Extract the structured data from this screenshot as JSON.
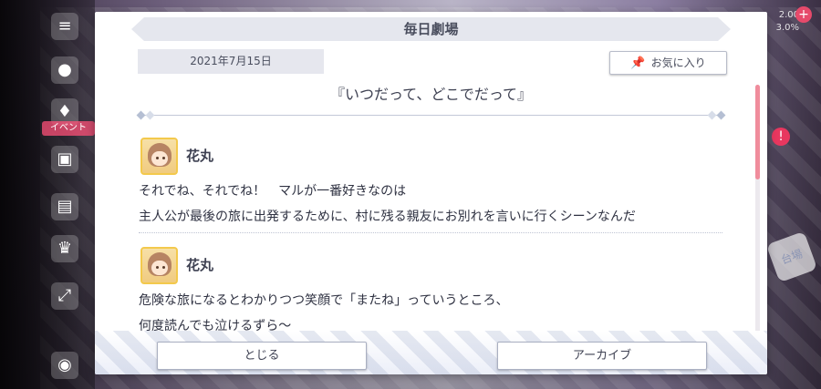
{
  "screen": {
    "background": {
      "side_menu_tag": "イベント",
      "top_right_text": "2.00\n3.0%",
      "right_deco_text": "台場"
    }
  },
  "dialog": {
    "title": "毎日劇場",
    "date": "2021年7月15日",
    "favorite_button": {
      "label": "お気に入り",
      "icon": "pin-icon"
    },
    "episode_title": "『いつだって、どこでだって』",
    "messages": [
      {
        "speaker": "花丸",
        "lines": [
          "それでね、それでね！　マルが一番好きなのは",
          "主人公が最後の旅に出発するために、村に残る親友にお別れを言いに行くシーンなんだ"
        ]
      },
      {
        "speaker": "花丸",
        "lines": [
          "危険な旅になるとわかりつつ笑顔で「またね」っていうところ、",
          "何度読んでも泣けるずら～"
        ]
      }
    ],
    "buttons": {
      "close_label": "とじる",
      "archive_label": "アーカイブ"
    }
  },
  "colors": {
    "accent_scroll": "#f08c9c",
    "title_bar": "#e5e7ee",
    "avatar_border": "#f3c94c",
    "badge_red": "#e64a6b"
  }
}
